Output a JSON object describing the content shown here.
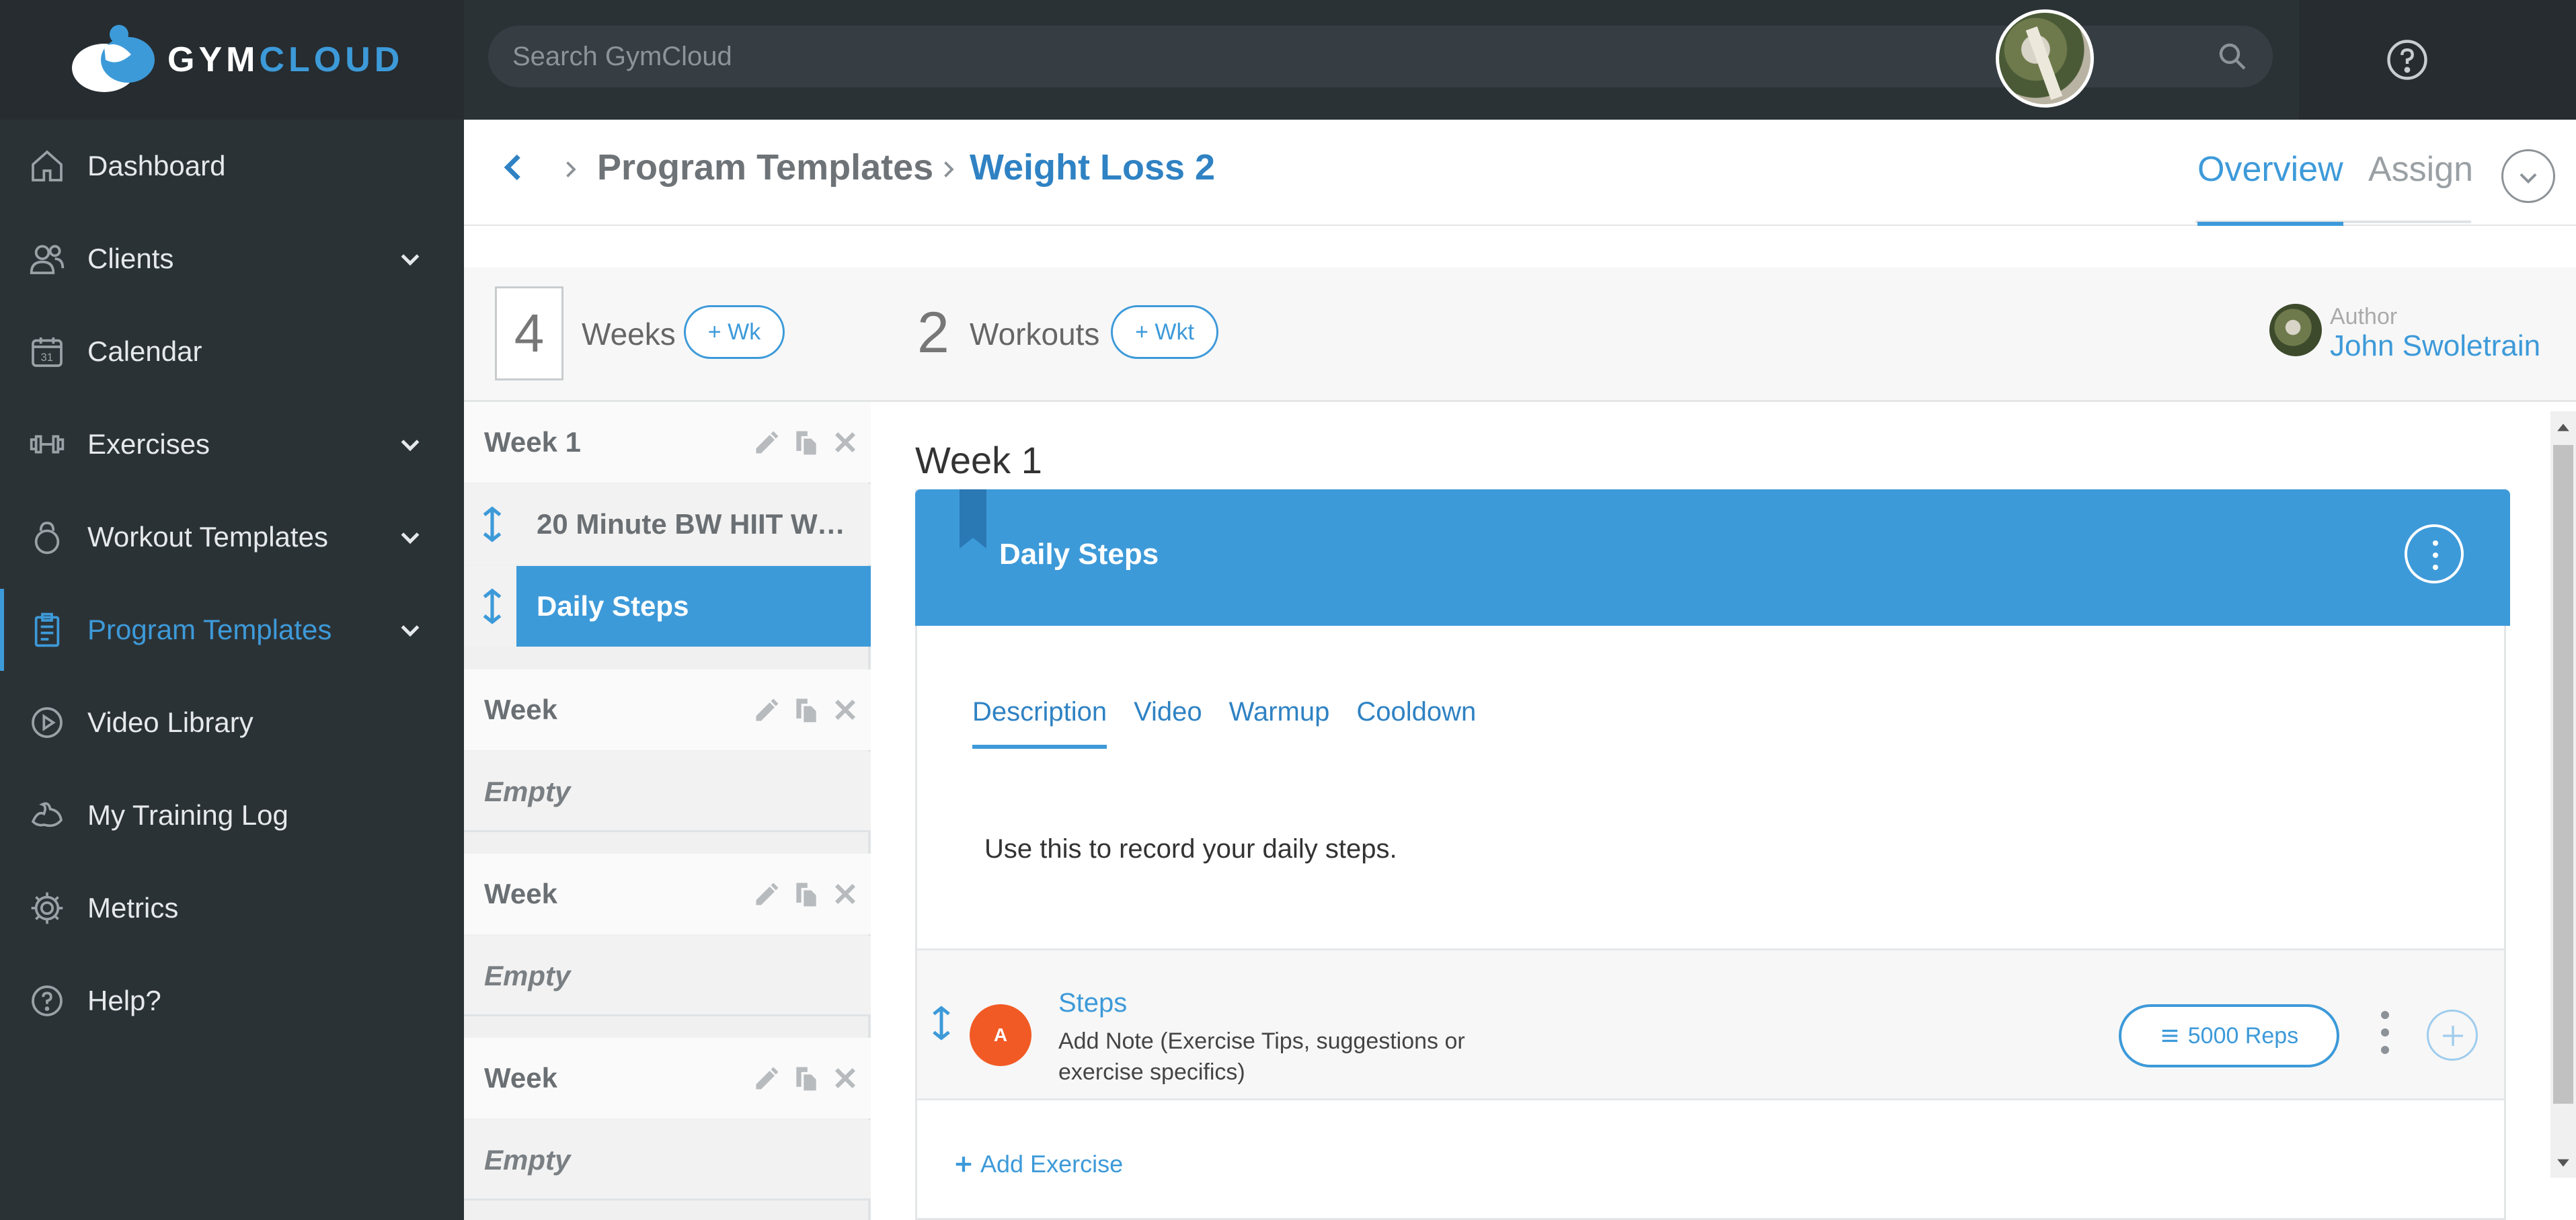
{
  "brand": {
    "part1": "GYM",
    "part2": "CLOUD"
  },
  "search": {
    "placeholder": "Search GymCloud"
  },
  "sidebar": {
    "items": [
      {
        "label": "Dashboard",
        "icon": "home-icon"
      },
      {
        "label": "Clients",
        "icon": "users-icon",
        "expandable": true
      },
      {
        "label": "Calendar",
        "icon": "calendar-icon"
      },
      {
        "label": "Exercises",
        "icon": "dumbbell-icon",
        "expandable": true
      },
      {
        "label": "Workout Templates",
        "icon": "kettlebell-icon",
        "expandable": true
      },
      {
        "label": "Program Templates",
        "icon": "clipboard-icon",
        "expandable": true,
        "active": true
      },
      {
        "label": "Video Library",
        "icon": "play-icon"
      },
      {
        "label": "My Training Log",
        "icon": "flex-arm-icon"
      },
      {
        "label": "Metrics",
        "icon": "gear-icon"
      },
      {
        "label": "Help?",
        "icon": "help-icon"
      }
    ]
  },
  "header": {
    "breadcrumb_parent": "Program Templates",
    "breadcrumb_current": "Weight Loss 2",
    "tab_overview": "Overview",
    "tab_assign": "Assign"
  },
  "stats": {
    "weeks_count": "4",
    "weeks_label": "Weeks",
    "add_week": "+ Wk",
    "workouts_count": "2",
    "workouts_label": "Workouts",
    "add_workout": "+ Wkt",
    "author_label": "Author",
    "author_name": "John Swoletrain"
  },
  "weeks": [
    {
      "title": "Week 1",
      "workouts": [
        "20 Minute BW HIIT Wor...",
        "Daily Steps"
      ]
    },
    {
      "title": "Week",
      "empty": "Empty"
    },
    {
      "title": "Week",
      "empty": "Empty"
    },
    {
      "title": "Week",
      "empty": "Empty"
    }
  ],
  "main": {
    "week_title": "Week 1",
    "card_title": "Daily Steps",
    "tabs": [
      "Description",
      "Video",
      "Warmup",
      "Cooldown"
    ],
    "description": "Use this to record your daily steps.",
    "exercise": {
      "badge": "A",
      "name": "Steps",
      "note": "Add Note (Exercise Tips, suggestions or exercise specifics)",
      "reps": "5000 Reps"
    },
    "add_exercise": "Add Exercise"
  },
  "colors": {
    "accent": "#3d9ad9",
    "sidebar": "#2b3236",
    "badge": "#f15a24"
  }
}
